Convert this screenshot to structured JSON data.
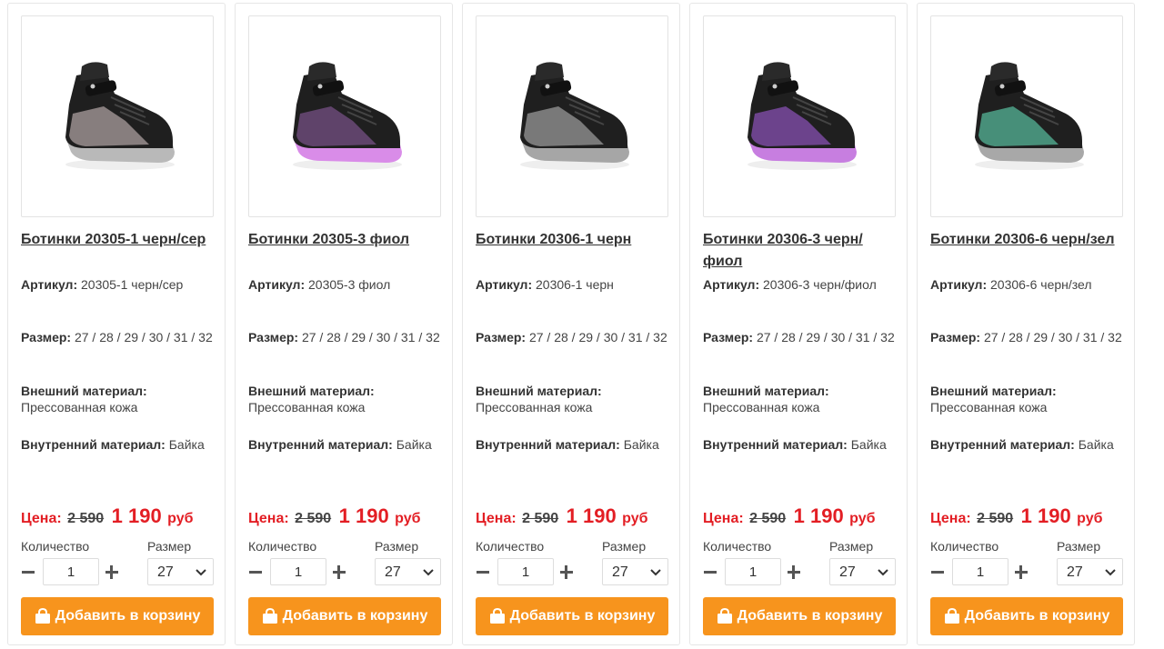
{
  "labels": {
    "article": "Артикул:",
    "size": "Размер:",
    "outer": "Внешний материал:",
    "inner": "Внутренний материал:",
    "price": "Цена:",
    "currency": "руб",
    "qty": "Количество",
    "size_select": "Размер",
    "cart": "Добавить в корзину"
  },
  "colors": {
    "accent": "#f7941d",
    "price": "#e31e24"
  },
  "products": [
    {
      "title": "Ботинки 20305-1 черн/сер",
      "article": "20305-1 черн/сер",
      "sizes": "27 / 28 / 29 / 30 / 31 / 32",
      "outer": "Прессованная кожа",
      "inner": "Байка",
      "old_price": "2 590",
      "new_price": "1 190",
      "qty": "1",
      "size": "27",
      "accent": "#9a8f8f",
      "sole": "#b9b9b9"
    },
    {
      "title": "Ботинки 20305-3 фиол",
      "article": "20305-3 фиол",
      "sizes": "27 / 28 / 29 / 30 / 31 / 32",
      "outer": "Прессованная кожа",
      "inner": "Байка",
      "old_price": "2 590",
      "new_price": "1 190",
      "qty": "1",
      "size": "27",
      "accent": "#6b4a78",
      "sole": "#d98ce8"
    },
    {
      "title": "Ботинки 20306-1 черн",
      "article": "20306-1 черн",
      "sizes": "27 / 28 / 29 / 30 / 31 / 32",
      "outer": "Прессованная кожа",
      "inner": "Байка",
      "old_price": "2 590",
      "new_price": "1 190",
      "qty": "1",
      "size": "27",
      "accent": "#8a8a8a",
      "sole": "#a6a6a6"
    },
    {
      "title": "Ботинки 20306-3 черн/фиол",
      "article": "20306-3 черн/фиол",
      "sizes": "27 / 28 / 29 / 30 / 31 / 32",
      "outer": "Прессованная кожа",
      "inner": "Байка",
      "old_price": "2 590",
      "new_price": "1 190",
      "qty": "1",
      "size": "27",
      "accent": "#7a4aa0",
      "sole": "#c77ee0"
    },
    {
      "title": "Ботинки 20306-6 черн/зел",
      "article": "20306-6 черн/зел",
      "sizes": "27 / 28 / 29 / 30 / 31 / 32",
      "outer": "Прессованная кожа",
      "inner": "Байка",
      "old_price": "2 590",
      "new_price": "1 190",
      "qty": "1",
      "size": "27",
      "accent": "#4fa38a",
      "sole": "#a8a8a8"
    }
  ]
}
